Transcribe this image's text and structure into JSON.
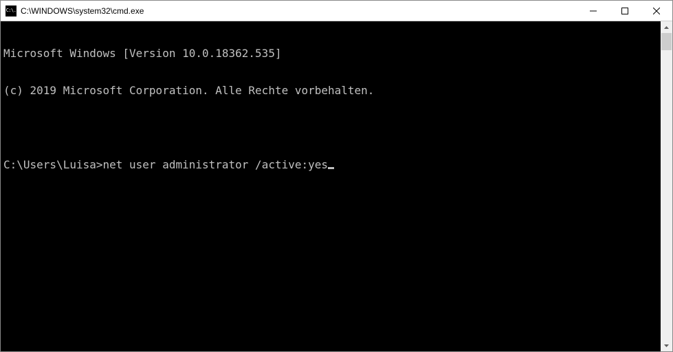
{
  "window": {
    "title": "C:\\WINDOWS\\system32\\cmd.exe",
    "icon_label": "C:\\."
  },
  "terminal": {
    "header_line": "Microsoft Windows [Version 10.0.18362.535]",
    "copyright_line": "(c) 2019 Microsoft Corporation. Alle Rechte vorbehalten.",
    "prompt": "C:\\Users\\Luisa>",
    "command": "net user administrator /active:yes"
  }
}
